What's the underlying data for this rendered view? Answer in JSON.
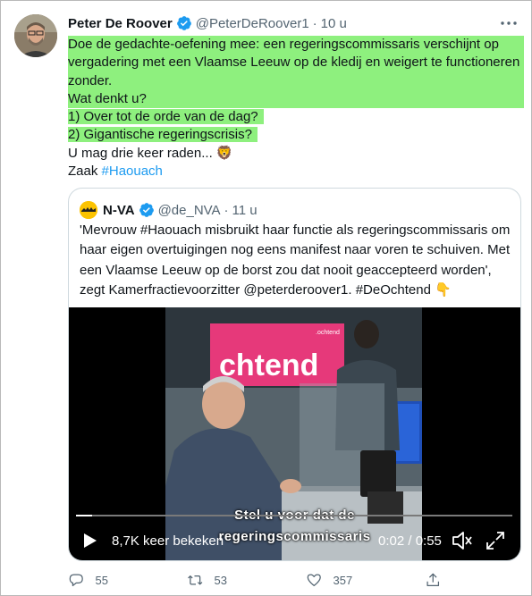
{
  "author": {
    "name": "Peter De Roover",
    "handle": "@PeterDeRoover1",
    "separator": "·",
    "time": "10 u"
  },
  "tweet": {
    "lines": [
      "Doe de gedachte-oefening mee: een regeringscommissaris verschijnt op",
      "vergadering met een Vlaamse Leeuw op de kledij en weigert te functioneren",
      "zonder.",
      "Wat denkt u?",
      "1) Over tot de orde van de dag?",
      "2) Gigantische regeringscrisis?",
      "U mag drie keer raden... 🦁"
    ],
    "last_prefix": "Zaak ",
    "hashtag": "#Haouach"
  },
  "quoted": {
    "name": "N-VA",
    "handle": "@de_NVA",
    "separator": "·",
    "time": "11 u",
    "lines": [
      "'Mevrouw #Haouach misbruikt haar functie als regeringscommissaris om",
      "haar eigen overtuigingen nog eens manifest naar voren te schuiven. Met",
      "een Vlaamse Leeuw op de borst zou dat nooit geaccepteerd worden',",
      "zegt Kamerfractievoorzitter @peterderoover1. #DeOchtend 👇"
    ],
    "video": {
      "screen_text": "chtend",
      "screen_small": ".ochtend",
      "subtitle_1": "Stel u voor dat de",
      "subtitle_2": "regeringscommissaris",
      "views": "8,7K keer bekeken",
      "time": "0:02 / 0:55",
      "progress": 0.036
    }
  },
  "actions": {
    "replies": "55",
    "retweets": "53",
    "likes": "357"
  },
  "colors": {
    "highlight": "#8ef07e",
    "link": "#1d9bf0",
    "verified": "#1d9bf0",
    "muted": "#536471"
  }
}
